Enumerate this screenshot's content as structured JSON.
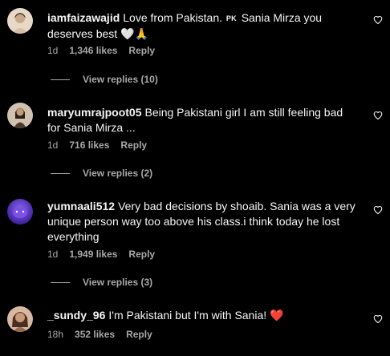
{
  "comments": [
    {
      "username": "iamfaizawajid",
      "text_before_flag": "Love from Pakistan.",
      "flag_text": "PK",
      "text_after_flag": "Sania Mirza you deserves best",
      "emojis": "🤍🙏",
      "time": "1d",
      "likes": "1,346 likes",
      "reply_label": "Reply",
      "view_replies": "View replies (10)",
      "avatar_color": "#d9c3b0"
    },
    {
      "username": "maryumrajpoot05",
      "text": "Being Pakistani girl I am still feeling bad for Sania Mirza ...",
      "time": "1d",
      "likes": "716 likes",
      "reply_label": "Reply",
      "view_replies": "View replies (2)",
      "avatar_color": "#5a4a3a"
    },
    {
      "username": "yumnaali512",
      "text": "Very bad decisions by shoaib. Sania was a very unique person way too above his class.i think today he lost everything",
      "time": "1d",
      "likes": "1,949 likes",
      "reply_label": "Reply",
      "view_replies": "View replies (3)",
      "avatar_color": "#6b3fd4"
    },
    {
      "username": "_sundy_96",
      "text": "I'm Pakistani but I'm with Sania!",
      "emojis": "❤️",
      "time": "18h",
      "likes": "352 likes",
      "reply_label": "Reply",
      "avatar_color": "#b98a6a"
    }
  ],
  "colors": {
    "background": "#000000",
    "primary_text": "#f5f5f5",
    "secondary_text": "#a8a8a8",
    "heart_red": "#ed4956"
  },
  "icons": [
    "heart-outline-icon",
    "avatar"
  ]
}
